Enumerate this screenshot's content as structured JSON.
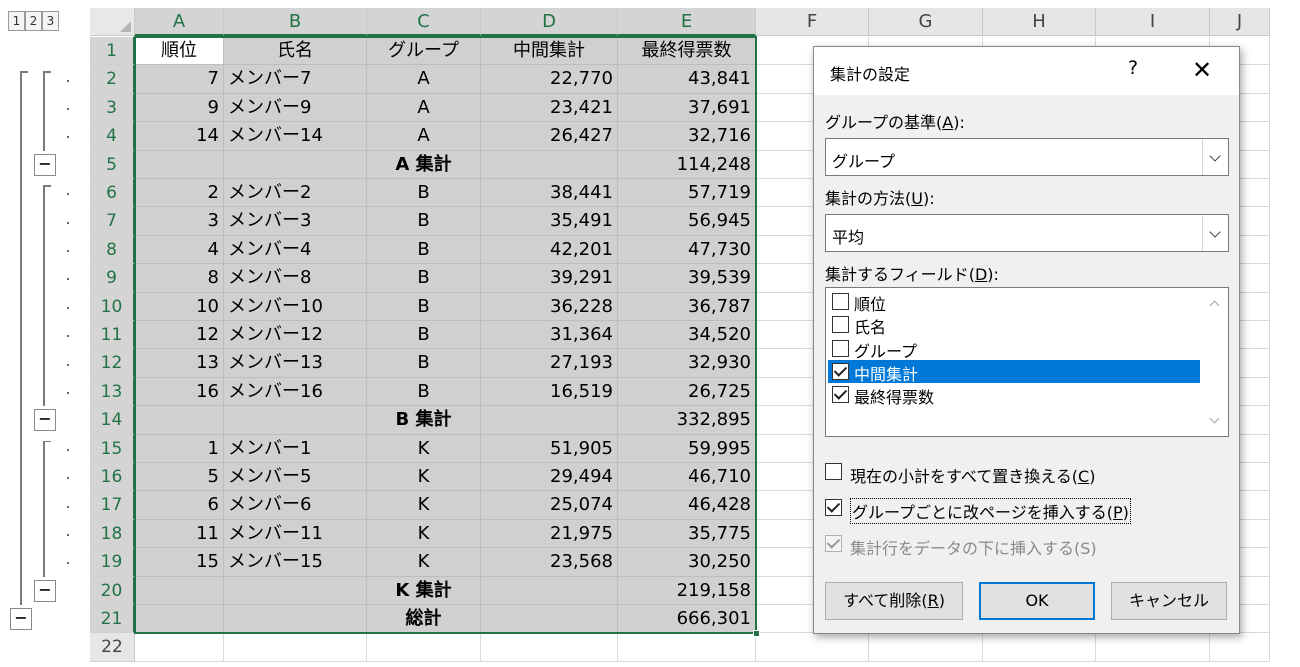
{
  "outline": {
    "levels": [
      "1",
      "2",
      "3"
    ],
    "collapse_symbol": "−"
  },
  "sheet": {
    "columns": [
      "A",
      "B",
      "C",
      "D",
      "E",
      "F",
      "G",
      "H",
      "I",
      "J"
    ],
    "rows": [
      {
        "num": "1",
        "cells": [
          "順位",
          "氏名",
          "グループ",
          "中間集計",
          "最終得票数"
        ],
        "type": "header"
      },
      {
        "num": "2",
        "cells": [
          "7",
          "メンバー7",
          "A",
          "22,770",
          "43,841"
        ]
      },
      {
        "num": "3",
        "cells": [
          "9",
          "メンバー9",
          "A",
          "23,421",
          "37,691"
        ]
      },
      {
        "num": "4",
        "cells": [
          "14",
          "メンバー14",
          "A",
          "26,427",
          "32,716"
        ]
      },
      {
        "num": "5",
        "cells": [
          "",
          "",
          "A 集計",
          "",
          "114,248"
        ],
        "type": "subtotal"
      },
      {
        "num": "6",
        "cells": [
          "2",
          "メンバー2",
          "B",
          "38,441",
          "57,719"
        ]
      },
      {
        "num": "7",
        "cells": [
          "3",
          "メンバー3",
          "B",
          "35,491",
          "56,945"
        ]
      },
      {
        "num": "8",
        "cells": [
          "4",
          "メンバー4",
          "B",
          "42,201",
          "47,730"
        ]
      },
      {
        "num": "9",
        "cells": [
          "8",
          "メンバー8",
          "B",
          "39,291",
          "39,539"
        ]
      },
      {
        "num": "10",
        "cells": [
          "10",
          "メンバー10",
          "B",
          "36,228",
          "36,787"
        ]
      },
      {
        "num": "11",
        "cells": [
          "12",
          "メンバー12",
          "B",
          "31,364",
          "34,520"
        ]
      },
      {
        "num": "12",
        "cells": [
          "13",
          "メンバー13",
          "B",
          "27,193",
          "32,930"
        ]
      },
      {
        "num": "13",
        "cells": [
          "16",
          "メンバー16",
          "B",
          "16,519",
          "26,725"
        ]
      },
      {
        "num": "14",
        "cells": [
          "",
          "",
          "B 集計",
          "",
          "332,895"
        ],
        "type": "subtotal"
      },
      {
        "num": "15",
        "cells": [
          "1",
          "メンバー1",
          "K",
          "51,905",
          "59,995"
        ]
      },
      {
        "num": "16",
        "cells": [
          "5",
          "メンバー5",
          "K",
          "29,494",
          "46,710"
        ]
      },
      {
        "num": "17",
        "cells": [
          "6",
          "メンバー6",
          "K",
          "25,074",
          "46,428"
        ]
      },
      {
        "num": "18",
        "cells": [
          "11",
          "メンバー11",
          "K",
          "21,975",
          "35,775"
        ]
      },
      {
        "num": "19",
        "cells": [
          "15",
          "メンバー15",
          "K",
          "23,568",
          "30,250"
        ]
      },
      {
        "num": "20",
        "cells": [
          "",
          "",
          "K 集計",
          "",
          "219,158"
        ],
        "type": "subtotal"
      },
      {
        "num": "21",
        "cells": [
          "",
          "",
          "総計",
          "",
          "666,301"
        ],
        "type": "subtotal"
      },
      {
        "num": "22",
        "cells": [
          "",
          "",
          "",
          "",
          ""
        ],
        "type": "empty"
      }
    ],
    "selection_color": "#217346"
  },
  "dialog": {
    "title": "集計の設定",
    "help": "?",
    "close": "✕",
    "group_by_label": "グループの基準",
    "group_by_key": "A",
    "group_by_value": "グループ",
    "function_label": "集計の方法",
    "function_key": "U",
    "function_value": "平均",
    "fields_label": "集計するフィールド",
    "fields_key": "D",
    "fields": [
      {
        "label": "順位",
        "checked": false
      },
      {
        "label": "氏名",
        "checked": false
      },
      {
        "label": "グループ",
        "checked": false
      },
      {
        "label": "中間集計",
        "checked": true
      },
      {
        "label": "最終得票数",
        "checked": true
      }
    ],
    "replace_label": "現在の小計をすべて置き換える",
    "replace_key": "C",
    "pagebreak_label": "グループごとに改ページを挿入する",
    "pagebreak_key": "P",
    "below_label": "集計行をデータの下に挿入する(S)",
    "remove_label": "すべて削除",
    "remove_key": "R",
    "ok_label": "OK",
    "cancel_label": "キャンセル",
    "accent_color": "#0078d7"
  }
}
